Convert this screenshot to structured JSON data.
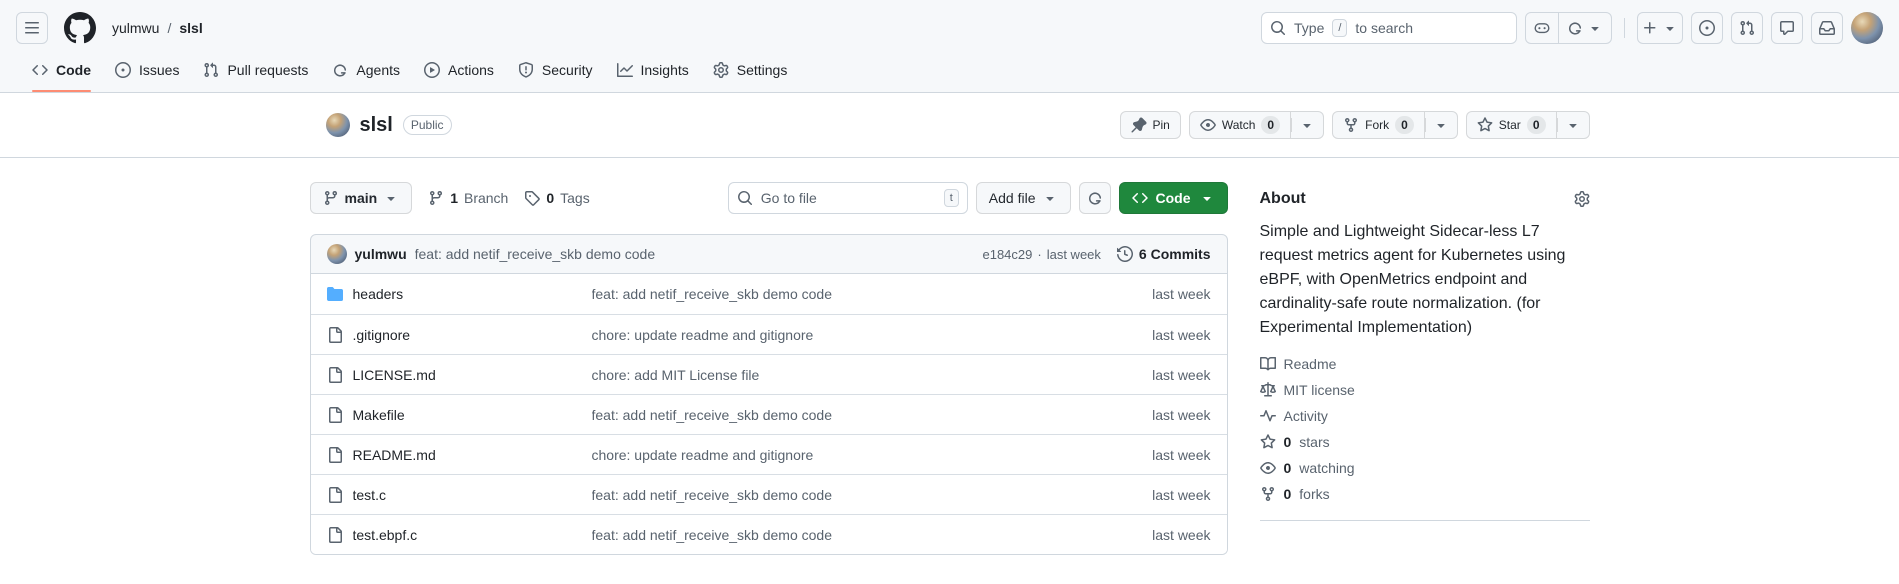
{
  "colors": {
    "button_green": "#1f883d",
    "tab_underline": "#fd8c73",
    "link_blue": "#0969da",
    "folder_blue": "#54aeff",
    "header_bg": "#f6f8fa",
    "border": "#d0d7de"
  },
  "app_header": {
    "breadcrumb": {
      "owner": "yulmwu",
      "separator": "/",
      "repo": "slsl"
    },
    "search": {
      "prefix": "Type",
      "key": "/",
      "suffix": "to search"
    },
    "nav_tabs": [
      {
        "label": "Code",
        "icon": "code",
        "active": true
      },
      {
        "label": "Issues",
        "icon": "issue-opened",
        "active": false
      },
      {
        "label": "Pull requests",
        "icon": "git-pull-request",
        "active": false
      },
      {
        "label": "Agents",
        "icon": "agent",
        "active": false
      },
      {
        "label": "Actions",
        "icon": "play",
        "active": false
      },
      {
        "label": "Security",
        "icon": "shield",
        "active": false
      },
      {
        "label": "Insights",
        "icon": "graph",
        "active": false
      },
      {
        "label": "Settings",
        "icon": "gear",
        "active": false
      }
    ]
  },
  "repo_header": {
    "title": "slsl",
    "visibility_badge": "Public",
    "pin_label": "Pin",
    "actions": [
      {
        "id": "watch",
        "icon": "eye",
        "label": "Watch",
        "count": "0"
      },
      {
        "id": "fork",
        "icon": "repo-forked",
        "label": "Fork",
        "count": "0"
      },
      {
        "id": "star",
        "icon": "star",
        "label": "Star",
        "count": "0"
      }
    ]
  },
  "toolbar": {
    "branch_button_label": "main",
    "branches": {
      "count": "1",
      "label": "Branch"
    },
    "tags": {
      "count": "0",
      "label": "Tags"
    },
    "go_to_file_placeholder": "Go to file",
    "go_to_file_key": "t",
    "add_file_label": "Add file",
    "code_button_label": "Code"
  },
  "commit_bar": {
    "author": "yulmwu",
    "message": "feat: add netif_receive_skb demo code",
    "sha": "e184c29",
    "separator": "·",
    "time": "last week",
    "commits_count_text": "6 Commits"
  },
  "files": [
    {
      "name": "headers",
      "type": "dir",
      "message": "feat: add netif_receive_skb demo code",
      "updated": "last week"
    },
    {
      "name": ".gitignore",
      "type": "file",
      "message": "chore: update readme and gitignore",
      "updated": "last week"
    },
    {
      "name": "LICENSE.md",
      "type": "file",
      "message": "chore: add MIT License file",
      "updated": "last week"
    },
    {
      "name": "Makefile",
      "type": "file",
      "message": "feat: add netif_receive_skb demo code",
      "updated": "last week"
    },
    {
      "name": "README.md",
      "type": "file",
      "message": "chore: update readme and gitignore",
      "updated": "last week"
    },
    {
      "name": "test.c",
      "type": "file",
      "message": "feat: add netif_receive_skb demo code",
      "updated": "last week"
    },
    {
      "name": "test.ebpf.c",
      "type": "file",
      "message": "feat: add netif_receive_skb demo code",
      "updated": "last week"
    }
  ],
  "sidebar": {
    "about_title": "About",
    "description": "Simple and Lightweight Sidecar-less L7 request metrics agent for Kubernetes using eBPF, with OpenMetrics endpoint and cardinality-safe route normalization. (for Experimental Implementation)",
    "meta_items": [
      {
        "icon": "book",
        "label": "Readme",
        "count": ""
      },
      {
        "icon": "law",
        "label": "MIT license",
        "count": ""
      },
      {
        "icon": "pulse",
        "label": "Activity",
        "count": ""
      },
      {
        "icon": "star",
        "label": "stars",
        "count": "0"
      },
      {
        "icon": "eye",
        "label": "watching",
        "count": "0"
      },
      {
        "icon": "repo-forked",
        "label": "forks",
        "count": "0"
      }
    ]
  }
}
